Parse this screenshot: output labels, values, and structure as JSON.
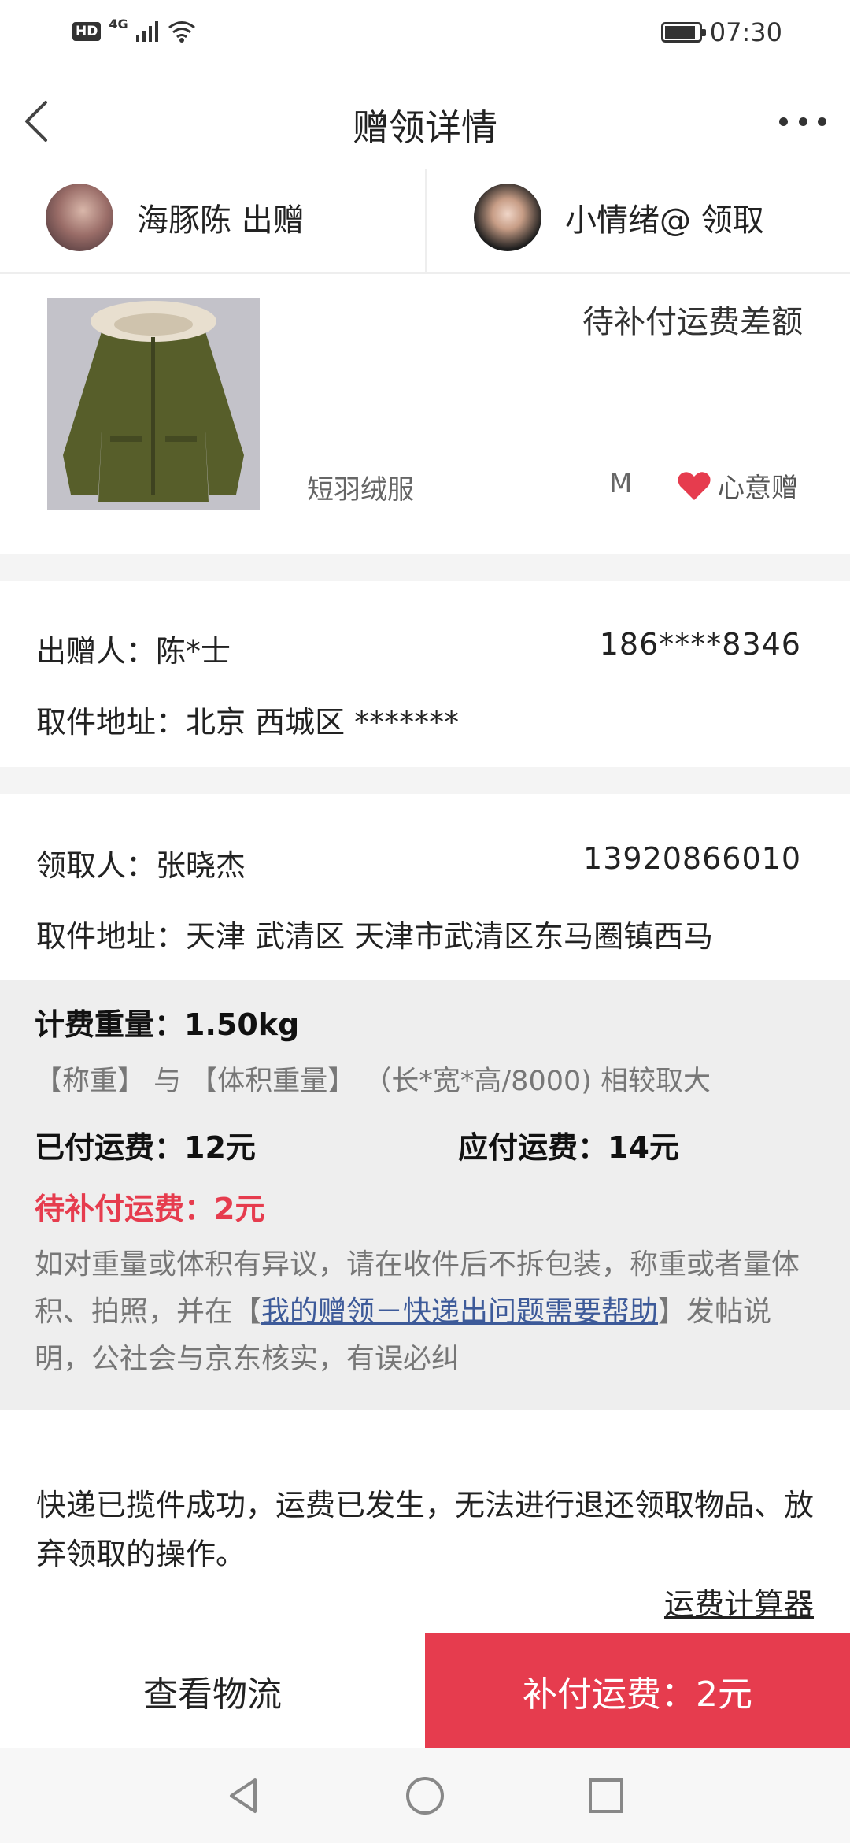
{
  "status_bar": {
    "hd": "HD",
    "network": "4G",
    "time": "07:30"
  },
  "nav": {
    "title": "赠领详情"
  },
  "parties": {
    "giver": {
      "name": "海豚陈",
      "action": "出赠"
    },
    "receiver": {
      "name": "小情绪@",
      "action": "领取"
    }
  },
  "item": {
    "status": "待补付运费差额",
    "name": "短羽绒服",
    "size": "M",
    "type": "心意赠"
  },
  "giver_info": {
    "label": "出赠人：",
    "name": "陈*士",
    "phone": "186****8346",
    "address_label": "取件地址：",
    "address": "北京 西城区 *******"
  },
  "receiver_info": {
    "label": "领取人：",
    "name": "张晓杰",
    "phone": "13920866010",
    "address_label": "取件地址：",
    "address": "天津 武清区 天津市武清区东马圈镇西马"
  },
  "fee": {
    "weight_label": "计费重量：",
    "weight": "1.50kg",
    "weight_note": "【称重】 与 【体积重量】 （长*宽*高/8000) 相较取大",
    "paid_label": "已付运费：",
    "paid": "12元",
    "due_label": "应付运费：",
    "due": "14元",
    "pending_label": "待补付运费：",
    "pending": "2元",
    "dispute_before": "如对重量或体积有异议，请在收件后不拆包装，称重或者量体积、拍照，并在【",
    "dispute_link": "我的赠领－快递出问题需要帮助",
    "dispute_after": "】发帖说明，公社会与京东核实，有误必纠"
  },
  "notice": "快递已揽件成功，运费已发生，无法进行退还领取物品、放弃领取的操作。",
  "calculator_link": "运费计算器",
  "actions": {
    "logistics": "查看物流",
    "pay": "补付运费：2元"
  },
  "colors": {
    "accent": "#e63c4e",
    "link": "#3d5a99",
    "panel": "#eeeeee"
  }
}
